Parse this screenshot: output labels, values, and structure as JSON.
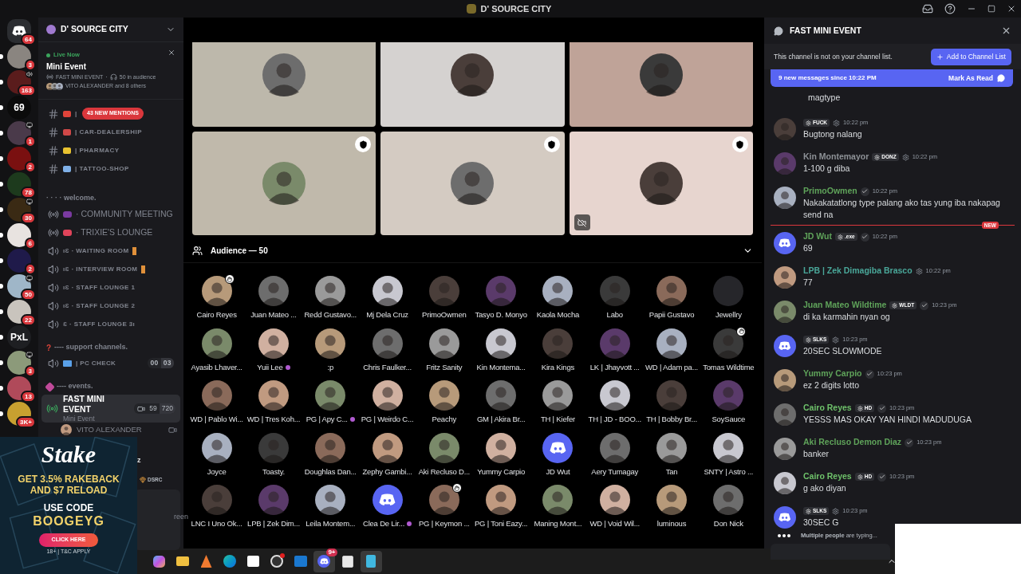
{
  "title_bar": {
    "title": "D' SOURCE CITY"
  },
  "servers": [
    {
      "color": "#2b2d31",
      "kind": "home",
      "badge": "64",
      "unread": false
    },
    {
      "color": "#8a8580",
      "kind": "server",
      "badge": "3",
      "unread": true
    },
    {
      "color": "#5a1c1c",
      "kind": "server",
      "badge": "163",
      "unread": true,
      "voice": true
    },
    {
      "color": "#0b0b0b",
      "kind": "server",
      "label": "69",
      "unread": true
    },
    {
      "color": "#4a3a4a",
      "kind": "server",
      "badge": "1",
      "unread": true,
      "screen": true
    },
    {
      "color": "#7a1010",
      "kind": "server",
      "badge": "2",
      "unread": true
    },
    {
      "color": "#1d3a1d",
      "kind": "server",
      "badge": "78",
      "unread": true
    },
    {
      "color": "#3a2a14",
      "kind": "server",
      "badge": "30",
      "unread": true,
      "screen": true
    },
    {
      "color": "#e8e3e0",
      "kind": "server",
      "badge": "6",
      "unread": true
    },
    {
      "color": "#1f1a4a",
      "kind": "server",
      "badge": "2",
      "unread": true
    },
    {
      "color": "#9fb6c8",
      "kind": "server",
      "badge": "50",
      "unread": true,
      "screen": true
    },
    {
      "color": "#c9c4bd",
      "kind": "server",
      "badge": "22",
      "unread": true
    },
    {
      "color": "#1e1f22",
      "kind": "server",
      "label": "PxL",
      "unread": true
    },
    {
      "color": "#8c9a7a",
      "kind": "server",
      "badge": "3",
      "unread": true,
      "screen": true
    },
    {
      "color": "#b04a5a",
      "kind": "server",
      "badge": "13",
      "unread": true
    },
    {
      "color": "#c8a030",
      "kind": "server",
      "badge": "3K+",
      "unread": true
    }
  ],
  "sidebar": {
    "server_name": "D' SOURCE CITY",
    "live": {
      "status": "Live Now",
      "title": "Mini Event",
      "stage": "FAST MINI EVENT",
      "separator": "·",
      "audience": "50 in audience",
      "speakers": "VITO ALEXANDER and 8 others"
    },
    "mentions": "43 NEW MENTIONS",
    "channels": [
      {
        "kind": "text",
        "color": "#e0443a",
        "name": "|"
      },
      {
        "kind": "text",
        "color": "#d04848",
        "name": "| CAR-DEALERSHIP"
      },
      {
        "kind": "text",
        "color": "#e8c230",
        "name": "| PHARMACY"
      },
      {
        "kind": "text",
        "color": "#7fb0e8",
        "name": "| TATTOO-SHOP"
      },
      {
        "kind": "category",
        "name": "· · · · welcome."
      },
      {
        "kind": "stage",
        "color": "#7a3aa0",
        "name": "· COMMUNITY MEETING",
        "selected": false
      },
      {
        "kind": "stage",
        "color": "#e0445a",
        "name": "· TRIXIE'S LOUNGE",
        "selected": false
      },
      {
        "kind": "voice",
        "name": "ıƐ · WAITING ROOM",
        "marker": true
      },
      {
        "kind": "voice",
        "name": "ıƐ · INTERVIEW ROOM",
        "marker": true
      },
      {
        "kind": "voice",
        "name": "ıƐ · STAFF LOUNGE 1",
        "marker": false
      },
      {
        "kind": "voice",
        "name": "ıƐ · STAFF LOUNGE 2",
        "marker": false
      },
      {
        "kind": "voice",
        "name": "Ɛ · STAFF LOUNGE 3ı",
        "marker": false
      },
      {
        "kind": "category",
        "prefix": "?",
        "name": "---- support channels."
      },
      {
        "kind": "voice",
        "color": "#5aa0e8",
        "name": "| PC CHECK",
        "marker": false,
        "counts": [
          "00",
          "03"
        ]
      },
      {
        "kind": "category",
        "color": "#c04a9a",
        "name": "---- events."
      },
      {
        "kind": "stage",
        "name": "FAST MINI EVENT",
        "subtitle": "Mini Event",
        "selected": true,
        "counts": [
          "59",
          "720"
        ]
      },
      {
        "kind": "member",
        "name": "VITO ALEXANDER"
      }
    ],
    "fragments": {
      "user": "z",
      "tag": "DSRC",
      "button": "reen"
    }
  },
  "stage": {
    "tiles": [
      {
        "color": "#bdb8ab",
        "shield": false,
        "camera_off": false
      },
      {
        "color": "#d5d2d0",
        "shield": false,
        "camera_off": false
      },
      {
        "color": "#bfa398",
        "shield": false,
        "camera_off": false
      },
      {
        "color": "#c0b9ab",
        "shield": true,
        "camera_off": false
      },
      {
        "color": "#d4cbc2",
        "shield": true,
        "camera_off": false
      },
      {
        "color": "#e7d5cf",
        "shield": true,
        "camera_off": true
      }
    ],
    "audience_title": "Audience — 50",
    "audience": [
      {
        "name": "Cairo Reyes",
        "kind": "photo",
        "hand": true,
        "boost": false
      },
      {
        "name": "Juan Mateo ...",
        "kind": "photo",
        "hand": false,
        "boost": false
      },
      {
        "name": "Redd Gustavo...",
        "kind": "photo",
        "hand": false,
        "boost": false
      },
      {
        "name": "Mj Dela Cruz",
        "kind": "photo",
        "hand": false,
        "boost": false
      },
      {
        "name": "PrimoOwmen",
        "kind": "photo",
        "hand": false,
        "boost": false
      },
      {
        "name": "Tasyo D. Monyo",
        "kind": "photo",
        "hand": false,
        "boost": false
      },
      {
        "name": "Kaola Mocha",
        "kind": "photo",
        "hand": false,
        "boost": false
      },
      {
        "name": "Labo",
        "kind": "photo",
        "hand": false,
        "boost": false
      },
      {
        "name": "Papii Gustavo",
        "kind": "photo",
        "hand": false,
        "boost": false
      },
      {
        "name": "Jewellry",
        "kind": "loading",
        "hand": false,
        "boost": false
      },
      {
        "name": "Ayasib Lhaver...",
        "kind": "photo",
        "hand": false,
        "boost": false
      },
      {
        "name": "Yuii Lee",
        "kind": "photo",
        "hand": false,
        "boost": true
      },
      {
        "name": ":p",
        "kind": "photo",
        "hand": false,
        "boost": false
      },
      {
        "name": "Chris Faulker...",
        "kind": "photo",
        "hand": false,
        "boost": false
      },
      {
        "name": "Fritz Sanity",
        "kind": "photo",
        "hand": false,
        "boost": false
      },
      {
        "name": "Kin Montema...",
        "kind": "photo",
        "hand": false,
        "boost": false
      },
      {
        "name": "Kira Kings",
        "kind": "photo",
        "hand": false,
        "boost": false
      },
      {
        "name": "LK | Jhayvott ...",
        "kind": "photo",
        "hand": false,
        "boost": false
      },
      {
        "name": "WD | Adam pa...",
        "kind": "photo",
        "hand": false,
        "boost": false
      },
      {
        "name": "Tomas Wildtime",
        "kind": "photo",
        "hand": true,
        "boost": false
      },
      {
        "name": "WD | Pablo Wi...",
        "kind": "photo",
        "hand": false,
        "boost": false
      },
      {
        "name": "WD | Tres Koh...",
        "kind": "photo",
        "hand": false,
        "boost": false
      },
      {
        "name": "PG | Apy C...",
        "kind": "photo",
        "hand": false,
        "boost": true
      },
      {
        "name": "PG | Weirdo C...",
        "kind": "photo",
        "hand": false,
        "boost": false
      },
      {
        "name": "Peachy",
        "kind": "photo",
        "hand": false,
        "boost": false
      },
      {
        "name": "GM | Akira Br...",
        "kind": "photo",
        "hand": false,
        "boost": false
      },
      {
        "name": "TH | Kiefer",
        "kind": "photo",
        "hand": false,
        "boost": false
      },
      {
        "name": "TH | JD - BOO...",
        "kind": "photo",
        "hand": false,
        "boost": false
      },
      {
        "name": "TH | Bobby Br...",
        "kind": "photo",
        "hand": false,
        "boost": false
      },
      {
        "name": "SoySauce",
        "kind": "photo",
        "hand": false,
        "boost": false
      },
      {
        "name": "Joyce",
        "kind": "photo",
        "hand": false,
        "boost": false
      },
      {
        "name": "Toasty.",
        "kind": "photo",
        "hand": false,
        "boost": false
      },
      {
        "name": "Doughlas Dan...",
        "kind": "photo",
        "hand": false,
        "boost": false
      },
      {
        "name": "Zephy Gambi...",
        "kind": "photo",
        "hand": false,
        "boost": false
      },
      {
        "name": "Aki Recluso D...",
        "kind": "photo",
        "hand": false,
        "boost": false
      },
      {
        "name": "Yummy Carpio",
        "kind": "photo",
        "hand": false,
        "boost": false
      },
      {
        "name": "JD Wut",
        "kind": "default",
        "hand": false,
        "boost": false
      },
      {
        "name": "Aery Tumagay",
        "kind": "photo",
        "hand": false,
        "boost": false
      },
      {
        "name": "Tan",
        "kind": "photo",
        "hand": false,
        "boost": false
      },
      {
        "name": "SNTY | Astro ...",
        "kind": "photo",
        "hand": false,
        "boost": false
      },
      {
        "name": "LNC I Uno Ok...",
        "kind": "photo",
        "hand": false,
        "boost": false
      },
      {
        "name": "LPB | Zek Dim...",
        "kind": "photo",
        "hand": false,
        "boost": false
      },
      {
        "name": "Leila Montem...",
        "kind": "photo",
        "hand": false,
        "boost": false
      },
      {
        "name": "Clea De Lir...",
        "kind": "default",
        "hand": false,
        "boost": true
      },
      {
        "name": "PG | Keymon ...",
        "kind": "photo",
        "hand": true,
        "boost": false
      },
      {
        "name": "PG | Toni Eazy...",
        "kind": "photo",
        "hand": false,
        "boost": false
      },
      {
        "name": "Maning Mont...",
        "kind": "photo",
        "hand": false,
        "boost": false
      },
      {
        "name": "WD | Void Wil...",
        "kind": "photo",
        "hand": false,
        "boost": false
      },
      {
        "name": "luminous",
        "kind": "photo",
        "hand": false,
        "boost": false
      },
      {
        "name": "Don Nick",
        "kind": "photo",
        "hand": false,
        "boost": false
      }
    ]
  },
  "chat": {
    "title": "FAST MINI EVENT",
    "notice": "This channel is not on your channel list.",
    "add_button": "Add to Channel List",
    "new_messages": "9 new messages since 10:22 PM",
    "mark_read": "Mark As Read",
    "messages": [
      {
        "kind": "continuation",
        "text": "magtype"
      },
      {
        "kind": "message",
        "tag": "FUCK",
        "role_icon": true,
        "verified": false,
        "time": "10:22 pm",
        "text": "Bugtong nalang"
      },
      {
        "kind": "message",
        "name": "Kin Montemayor",
        "color": "#8e9297",
        "tag": "DONZ",
        "role_icon": true,
        "verified": false,
        "time": "10:22 pm",
        "text": "1-100 g diba"
      },
      {
        "kind": "message",
        "name": "PrimoOwmen",
        "color": "#5fa35a",
        "role_icon": false,
        "verified": true,
        "time": "10:22 pm",
        "text": "Nakakatatlong type palang ako tas yung iba nakapag send na"
      },
      {
        "kind": "divider",
        "text": "NEW"
      },
      {
        "kind": "default_message",
        "name": "JD Wut",
        "color": "#5fa35a",
        "tag": ".exe",
        "role_icon": false,
        "verified": true,
        "time": "10:22 pm",
        "text": "69"
      },
      {
        "kind": "message",
        "name": "LPB | Zek Dimagiba Brasco",
        "color": "#4aa89a",
        "role_icon": true,
        "verified": false,
        "time": "10:22 pm",
        "text": "77"
      },
      {
        "kind": "message",
        "name": "Juan Mateo Wildtime",
        "color": "#5fa35a",
        "tag": "WLDT",
        "role_icon": false,
        "verified": true,
        "time": "10:23 pm",
        "text": "di ka karmahin nyan og"
      },
      {
        "kind": "default_message",
        "tag": "SLKS",
        "role_icon": true,
        "verified": false,
        "time": "10:23 pm",
        "text": "20SEC SLOWMODE"
      },
      {
        "kind": "message",
        "name": "Yummy Carpio",
        "color": "#5fa35a",
        "role_icon": false,
        "verified": true,
        "time": "10:23 pm",
        "text": "ez 2 digits lotto"
      },
      {
        "kind": "message",
        "name": "Cairo Reyes",
        "color": "#6ec16a",
        "tag": "HD",
        "role_icon": false,
        "verified": true,
        "time": "10:23 pm",
        "text": "YESSS MAS OKAY YAN HINDI MADUDUGA"
      },
      {
        "kind": "message",
        "name": "Aki Recluso Demon Diaz",
        "color": "#5fa35a",
        "role_icon": false,
        "verified": true,
        "time": "10:23 pm",
        "text": "banker"
      },
      {
        "kind": "message",
        "name": "Cairo Reyes",
        "color": "#6ec16a",
        "tag": "HD",
        "role_icon": false,
        "verified": true,
        "time": "10:23 pm",
        "text": "g ako diyan"
      },
      {
        "kind": "default_message",
        "tag": "SLKS",
        "role_icon": true,
        "verified": false,
        "time": "10:23 pm",
        "text": "30SEC G"
      }
    ],
    "typing": "**Multiple people** are typing..."
  },
  "ad": {
    "logo": "Stake",
    "offer": [
      "GET 3.5% RAKEBACK",
      "AND $7 RELOAD"
    ],
    "code_label": "USE CODE",
    "code": "BOOGEYG",
    "button": "CLICK HERE",
    "fine_print": "18+ | T&C APPLY"
  },
  "taskbar": {
    "apps": [
      {
        "kind": "copilot",
        "active": false
      },
      {
        "kind": "folder",
        "active": false
      },
      {
        "kind": "letter",
        "active": false
      },
      {
        "kind": "edge",
        "active": false
      },
      {
        "kind": "store",
        "active": false
      },
      {
        "kind": "obs",
        "active": false,
        "dot": true
      },
      {
        "kind": "mail",
        "active": false
      },
      {
        "kind": "chat",
        "active": true,
        "badge": "9+"
      },
      {
        "kind": "snip",
        "active": false
      },
      {
        "kind": "notepad",
        "active": true
      }
    ]
  }
}
